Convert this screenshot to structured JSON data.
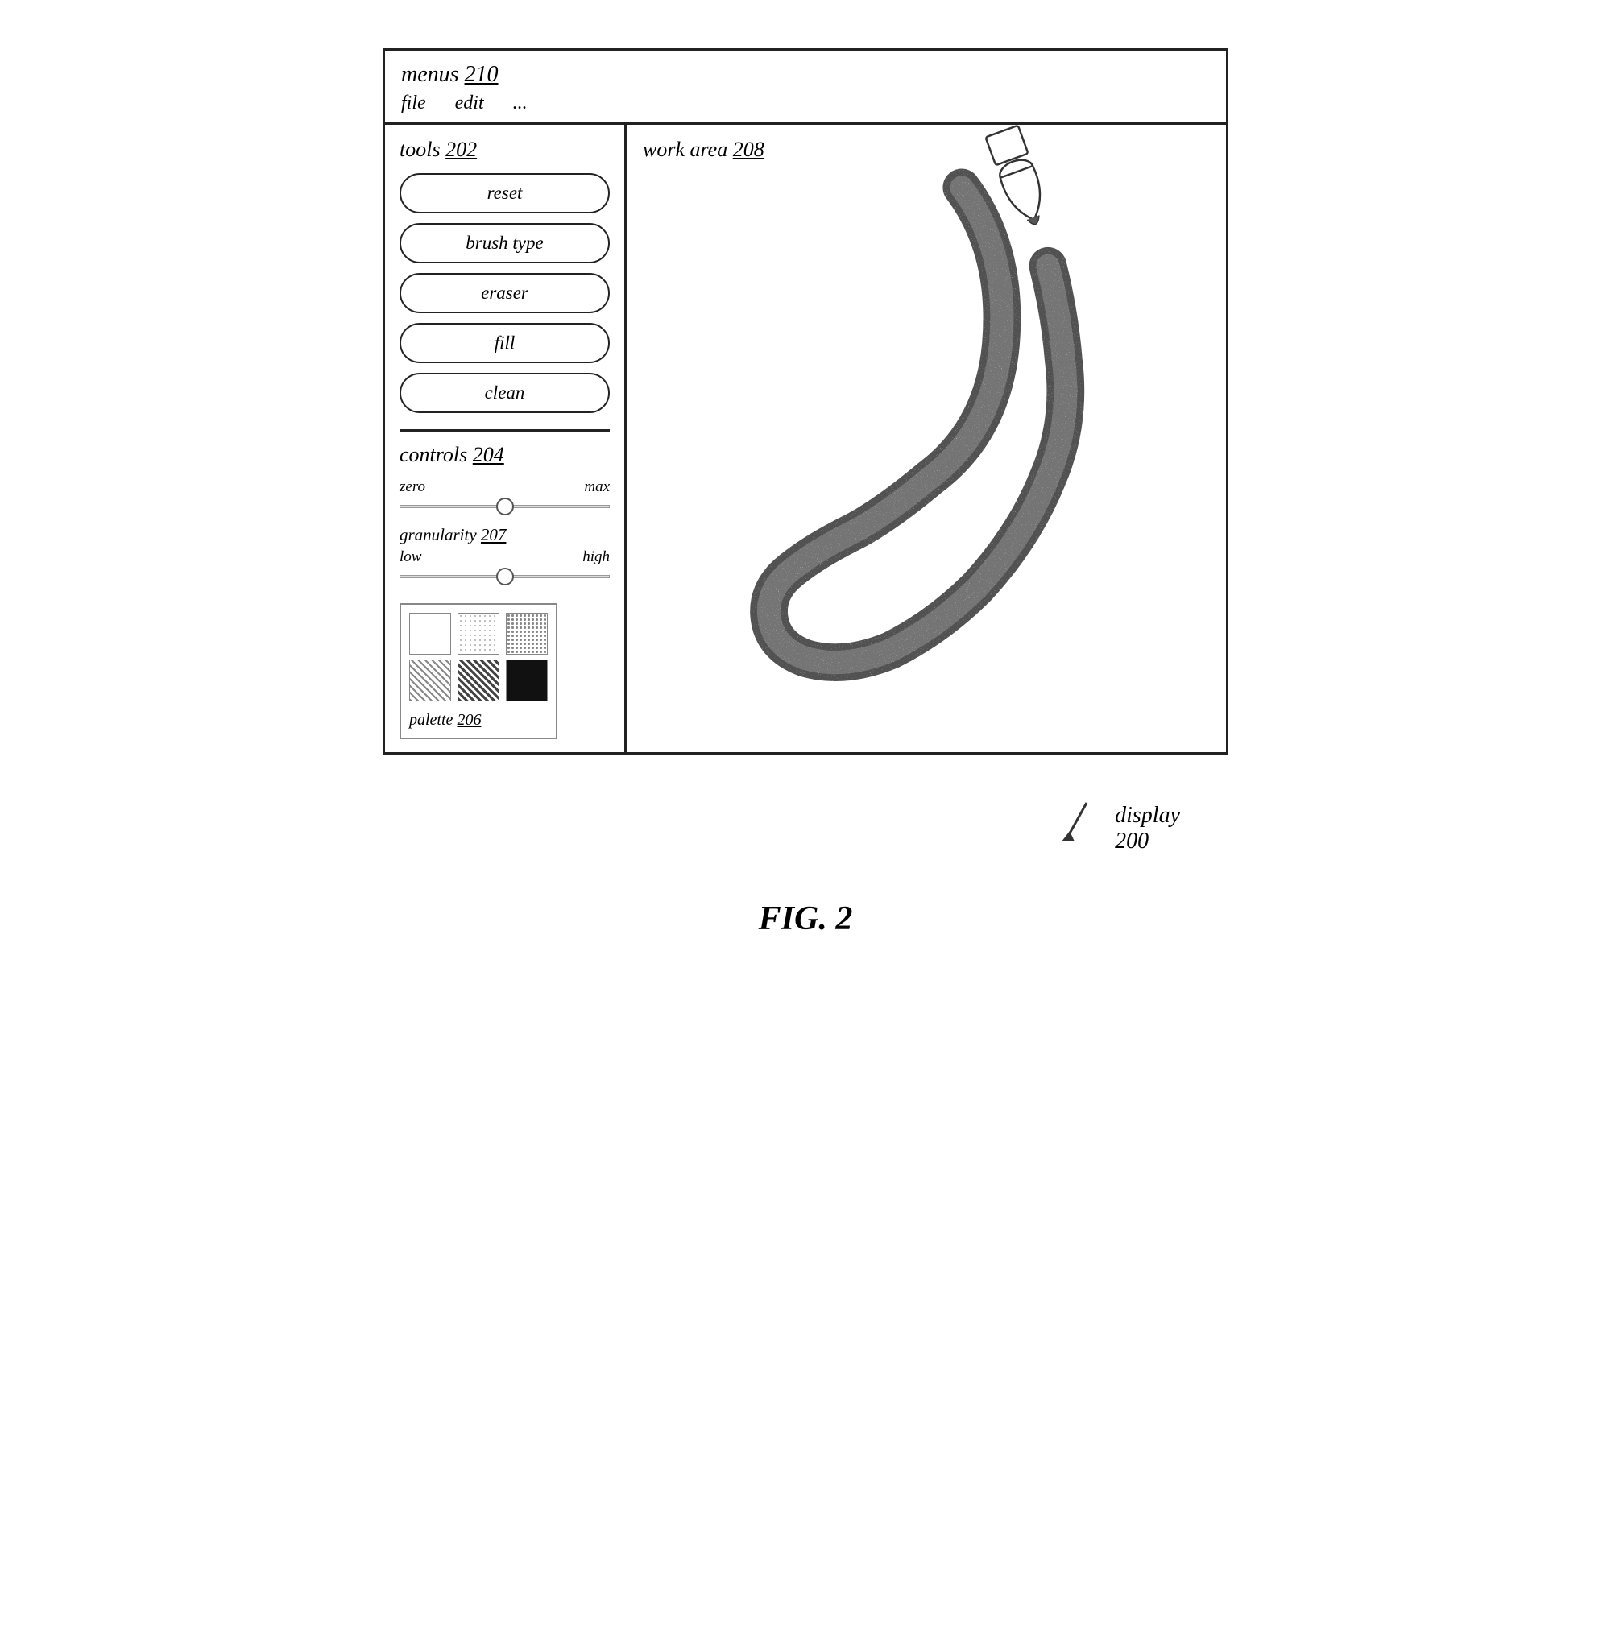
{
  "menus": {
    "label": "menus",
    "ref": "210",
    "items": [
      "file",
      "edit",
      "..."
    ]
  },
  "tools": {
    "label": "tools",
    "ref": "202",
    "buttons": [
      "reset",
      "brush type",
      "eraser",
      "fill",
      "clean"
    ]
  },
  "controls": {
    "label": "controls",
    "ref": "204",
    "slider1": {
      "min_label": "zero",
      "max_label": "max"
    },
    "granularity": {
      "label": "granularity",
      "ref": "207",
      "min_label": "low",
      "max_label": "high"
    },
    "palette": {
      "label": "palette",
      "ref": "206"
    }
  },
  "work_area": {
    "label": "work area",
    "ref": "208"
  },
  "display": {
    "label": "display",
    "ref": "200"
  },
  "fig_label": "FIG. 2"
}
